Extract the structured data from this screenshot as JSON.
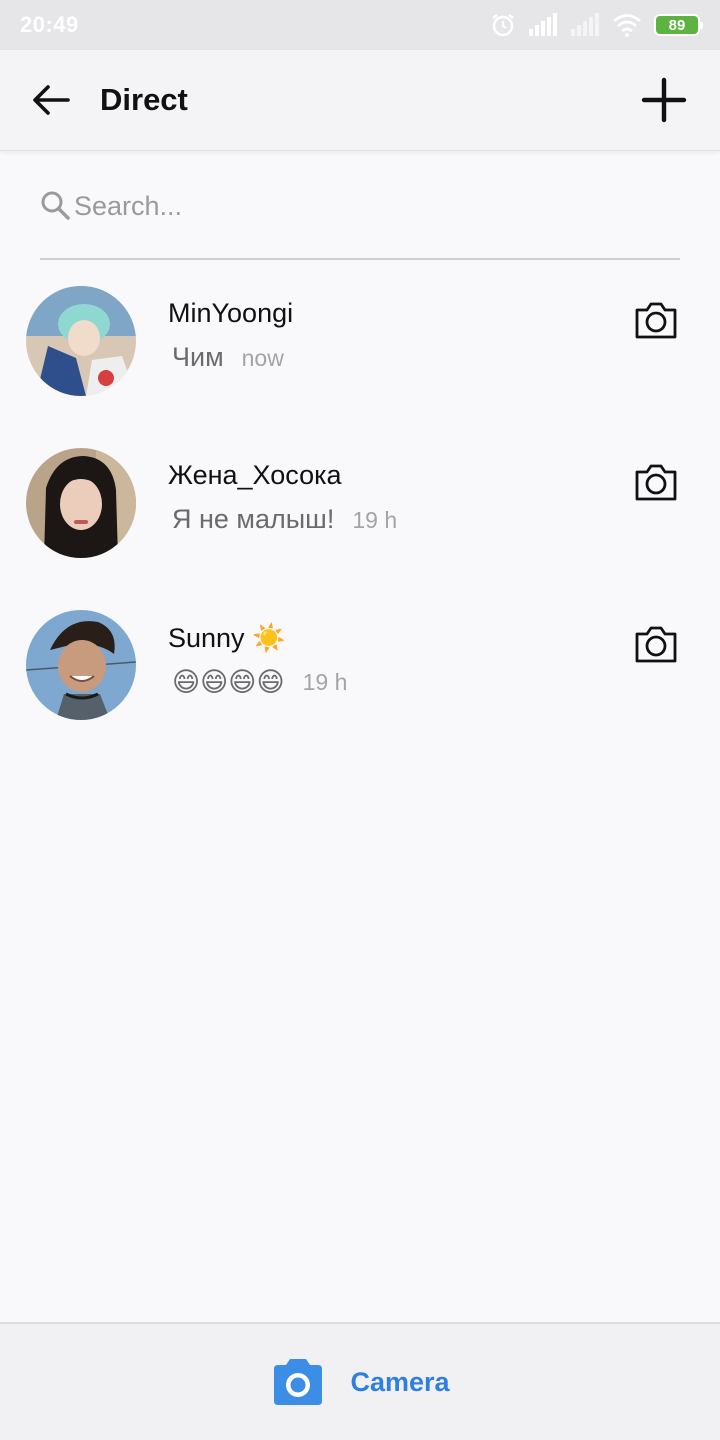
{
  "status_bar": {
    "time": "20:49",
    "battery": "89",
    "icons": [
      "alarm-icon",
      "signal-icon",
      "signal-weak-icon",
      "wifi-icon",
      "battery-icon"
    ]
  },
  "header": {
    "title": "Direct",
    "back_icon": "arrow-left-icon",
    "new_icon": "plus-icon"
  },
  "search": {
    "placeholder": "Search..."
  },
  "conversations": [
    {
      "name": "MinYoongi",
      "preview": "Чим",
      "time": "now"
    },
    {
      "name": "Жена_Хосока",
      "preview": "Я не малыш!",
      "time": "19 h"
    },
    {
      "name": "Sunny ☀️",
      "preview": "😄😄😄😄",
      "time": "19 h"
    }
  ],
  "bottom_bar": {
    "label": "Camera",
    "accent": "#2f7fe0"
  }
}
